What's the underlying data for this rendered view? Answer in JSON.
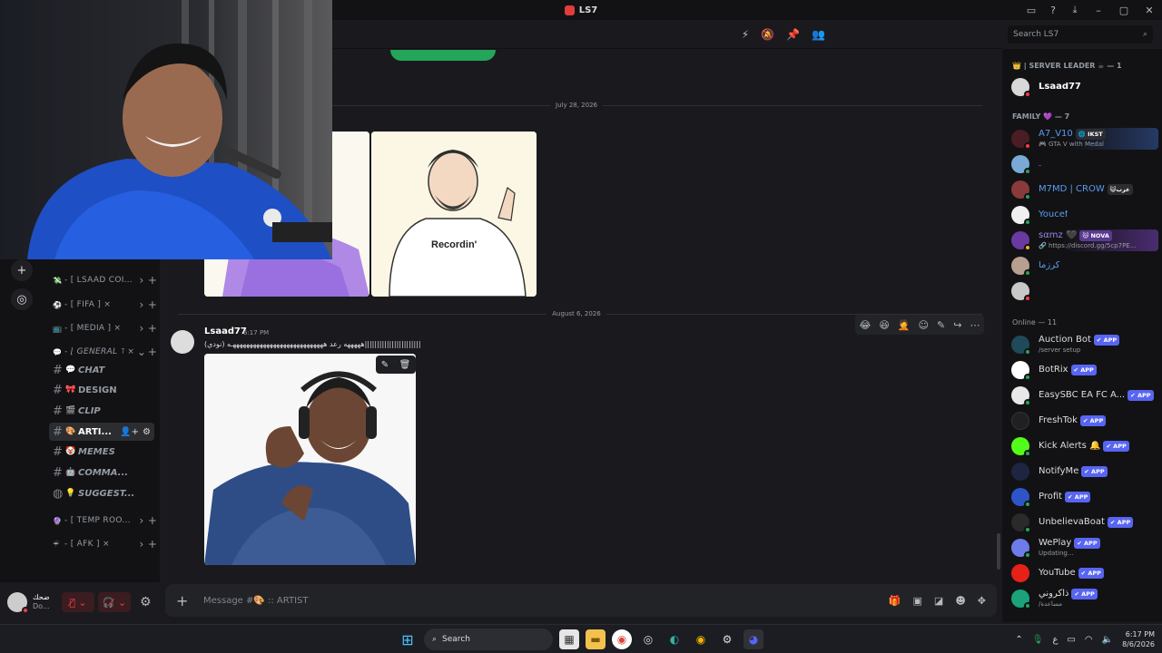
{
  "window": {
    "title": "LS7"
  },
  "search": {
    "placeholder": "Search LS7"
  },
  "dates": {
    "first": "July 28, 2026",
    "second": "August 6, 2026"
  },
  "sidebar": {
    "categories": [
      {
        "label": "- [ LSAAD COIN...",
        "emoji": "💸"
      },
      {
        "label": "- [ FIFA ] ×",
        "emoji": "⚽"
      },
      {
        "label": "- [ MEDIA ] ×",
        "emoji": "📺"
      },
      {
        "label": "- ⌊ GENERAL ˥ ×",
        "emoji": "💬"
      },
      {
        "label": "- [ TEMP ROO...",
        "emoji": "🔮"
      },
      {
        "label": "- [ AFK ] ×",
        "emoji": "☔"
      }
    ],
    "channels": [
      {
        "label": "CHAT",
        "emoji": "💬"
      },
      {
        "label": "DESIGN",
        "emoji": "🎀"
      },
      {
        "label": "CLIP",
        "emoji": "🎬"
      },
      {
        "label": "ARTI...",
        "emoji": "🎨"
      },
      {
        "label": "MEMES",
        "emoji": "🤡"
      },
      {
        "label": "COMMA...",
        "emoji": "🤖"
      },
      {
        "label": "SUGGEST...",
        "emoji": "💡"
      }
    ]
  },
  "user_panel": {
    "name": "ضحك",
    "status": "Do..."
  },
  "message": {
    "author": "Lsaad77",
    "time": "6:17 PM",
    "text": "(نودي) هههههه رعد ههههههههههههههههههههههههههههـه|||||||||||||||||||||||"
  },
  "composer": {
    "placeholder": "Message #🎨 ꞉꞉ ARTIST"
  },
  "members": {
    "groups": {
      "leader": "👑 | SERVER LEADER ☕ — 1",
      "family": "FAMILY 💜 — 7",
      "online": "Online — 11"
    },
    "leader": [
      {
        "name": "Lsaad77",
        "sub": ""
      }
    ],
    "family": [
      {
        "name": "A7_V10",
        "tag": "🌐 IKST",
        "sub": "🎮 GTA V with Medal"
      },
      {
        "name": "ـ",
        "tag": "",
        "sub": ""
      },
      {
        "name": "M7MD | CROW",
        "tag": "😺عرب",
        "sub": ""
      },
      {
        "name": "Youcef",
        "tag": "",
        "sub": ""
      },
      {
        "name": "sαmz 🖤",
        "tag": "😽 NOVA",
        "sub": "🔗 https://discord.gg/5cp7PE..."
      },
      {
        "name": "كرزما",
        "tag": "",
        "sub": ""
      },
      {
        "name": "",
        "tag": "",
        "sub": ""
      }
    ],
    "online": [
      {
        "name": "Auction Bot",
        "sub": "/server setup"
      },
      {
        "name": "BotRix",
        "sub": ""
      },
      {
        "name": "EasySBC EA FC A...",
        "sub": ""
      },
      {
        "name": "FreshTok",
        "sub": ""
      },
      {
        "name": "Kick Alerts 🔔",
        "sub": ""
      },
      {
        "name": "NotifyMe",
        "sub": ""
      },
      {
        "name": "Profit",
        "sub": ""
      },
      {
        "name": "UnbelievaBoat",
        "sub": ""
      },
      {
        "name": "WePlay",
        "sub": "Updating..."
      },
      {
        "name": "YouTube",
        "sub": ""
      },
      {
        "name": "ذاكروني",
        "sub": "/مساعدة"
      }
    ],
    "app_badge": "✔ APP"
  },
  "taskbar": {
    "search": "Search",
    "time": "6:17 PM",
    "date": "8/6/2026",
    "lang": "ع"
  },
  "colors": {
    "accent": "#5865f2",
    "online": "#23a55a",
    "dnd": "#f23f43",
    "background": "#1a1a1e"
  }
}
